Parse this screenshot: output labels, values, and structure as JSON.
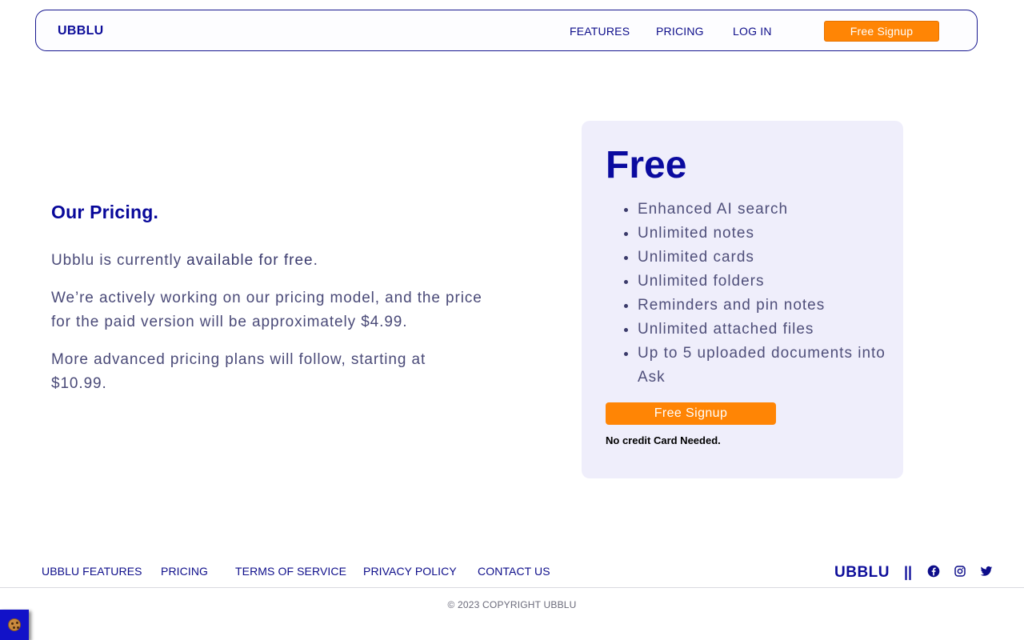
{
  "nav": {
    "brand": "UBBLU",
    "links": [
      "FEATURES",
      "PRICING",
      "LOG IN"
    ],
    "cta": "Free Signup"
  },
  "intro": {
    "heading": "Our Pricing.",
    "p1_prefix": "Ubblu is currently ",
    "p1_highlight": "available for free",
    "p1_suffix": ".",
    "p2": "We’re actively working on our pricing model, and the price for the paid version will be approximately $4.99.",
    "p3": "More advanced pricing plans will follow, starting at $10.99."
  },
  "plan": {
    "title": "Free",
    "features": [
      "Enhanced AI search",
      "Unlimited notes",
      "Unlimited cards",
      "Unlimited folders",
      "Reminders and pin notes",
      "Unlimited attached files",
      "Up to 5 uploaded documents into Ask"
    ],
    "cta": "Free Signup",
    "note": "No credit Card Needed."
  },
  "footer": {
    "links": [
      "UBBLU FEATURES",
      "PRICING",
      "TERMS OF SERVICE",
      "PRIVACY POLICY",
      "CONTACT US"
    ],
    "brand": "UBBLU",
    "separator": "||",
    "social_icons": [
      "facebook-icon",
      "instagram-icon",
      "twitter-icon"
    ],
    "copyright": "© 2023 COPYRIGHT UBBLU"
  },
  "cookie_icon": "cookie-icon",
  "colors": {
    "brand_blue": "#0b0b9c",
    "accent_orange": "#ff8505",
    "card_bg": "#efeefb",
    "body_text": "#4a4a78"
  }
}
